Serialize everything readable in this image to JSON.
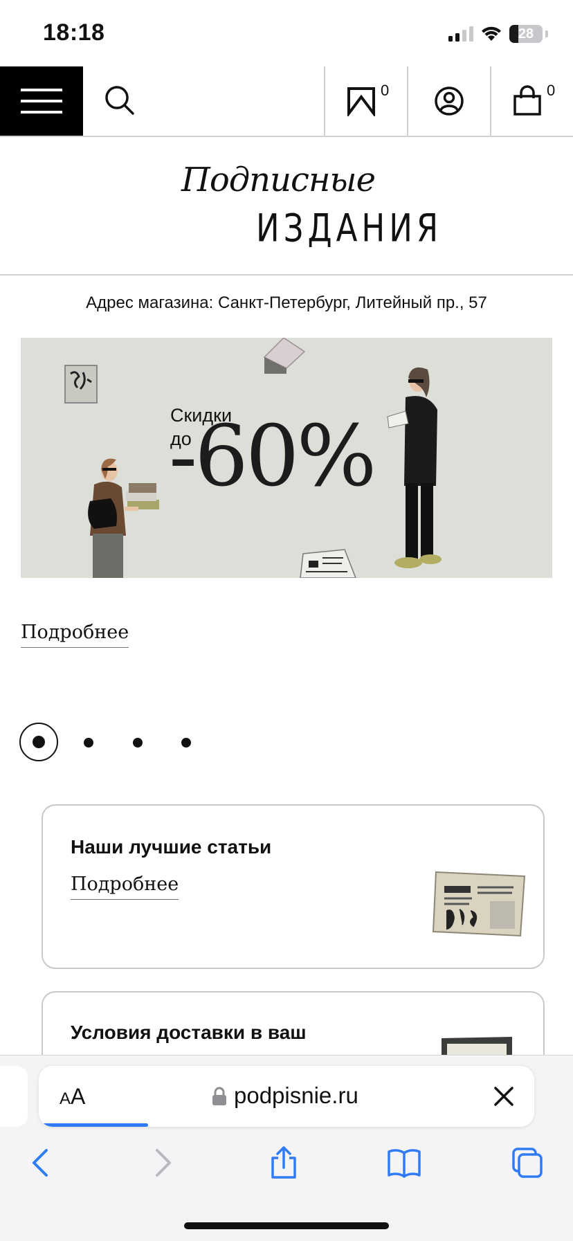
{
  "status_bar": {
    "time": "18:18",
    "battery": "28",
    "battery_level_percent": 28
  },
  "header": {
    "favorites_count": "0",
    "cart_count": "0"
  },
  "logo": {
    "script_text": "Подписные",
    "caps_text": "ИЗДАНИЯ"
  },
  "store_address": "Адрес магазина: Санкт-Петербург, Литейный пр., 57",
  "banner": {
    "headline_line1": "Скидки",
    "headline_line2": "до",
    "percent": "-60%",
    "background_color": "#dcdfd8"
  },
  "more_link": "Подробнее",
  "carousel": {
    "total_slides": 4,
    "active_index": 0
  },
  "cards": [
    {
      "title": "Наши лучшие статьи",
      "link": "Подробнее"
    },
    {
      "title": "Условия доставки в ваш",
      "link": ""
    }
  ],
  "browser": {
    "aa_label": "AA",
    "url": "podpisnie.ru",
    "load_progress_percent": 22,
    "accent_color": "#2f7bf5"
  },
  "icons": {
    "menu": "hamburger-icon",
    "search": "search-icon",
    "favorites": "bookmark-icon",
    "account": "user-icon",
    "cart": "shopping-bag-icon",
    "lock": "lock-icon",
    "close": "close-icon",
    "back": "back-chevron-icon",
    "forward": "forward-chevron-icon",
    "share": "share-icon",
    "bookmarks": "book-icon",
    "tabs": "tabs-icon"
  }
}
